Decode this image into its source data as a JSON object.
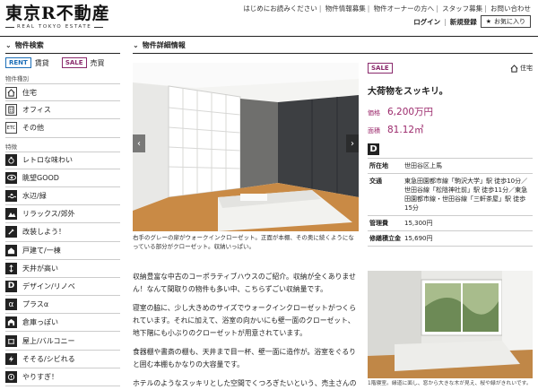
{
  "header": {
    "logo": "東京R不動産",
    "logo_sub": "REAL TOKYO ESTATE",
    "nav": [
      "はじめにお読みください",
      "物件情報募集",
      "物件オーナーの方へ",
      "スタッフ募集",
      "お問い合わせ"
    ],
    "login": "ログイン",
    "register": "新規登録",
    "favorites": "お気に入り"
  },
  "sidebar": {
    "title": "物件検索",
    "rent_badge": "RENT",
    "rent_label": "賃貸",
    "sale_badge": "SALE",
    "sale_label": "売買",
    "type_group": "物件種別",
    "types": [
      {
        "label": "住宅",
        "icon": "house-icon"
      },
      {
        "label": "オフィス",
        "icon": "office-icon"
      },
      {
        "label": "その他",
        "icon": "etc-icon",
        "glyph": "ETC"
      }
    ],
    "feature_group": "特徴",
    "features": [
      {
        "label": "レトロな味わい",
        "icon": "retro-icon"
      },
      {
        "label": "眺望GOOD",
        "icon": "eye-icon"
      },
      {
        "label": "水辺/緑",
        "icon": "waterside-icon"
      },
      {
        "label": "リラックス/郊外",
        "icon": "relax-icon"
      },
      {
        "label": "改装しよう！",
        "icon": "renovate-icon"
      },
      {
        "label": "戸建て/一棟",
        "icon": "detached-house-icon"
      },
      {
        "label": "天井が高い",
        "icon": "high-ceiling-icon"
      },
      {
        "label": "デザイン/リノベ",
        "icon": "design-icon",
        "glyph": "D"
      },
      {
        "label": "プラスα",
        "icon": "plus-alpha-icon",
        "glyph": "α"
      },
      {
        "label": "倉庫っぽい",
        "icon": "warehouse-icon"
      },
      {
        "label": "屋上/バルコニー",
        "icon": "rooftop-icon"
      },
      {
        "label": "そそる/シビれる",
        "icon": "exciting-icon"
      },
      {
        "label": "やりすぎ！",
        "icon": "overdone-icon"
      }
    ]
  },
  "main": {
    "section_title": "物件詳細情報",
    "photo_caption": "右手のグレーの扉がウォークインクローゼット。正面が本棚、その奥に続くようになっている部分がクローゼット。収納いっぱい。",
    "description": [
      "収納豊富な中古のコーポラティブハウスのご紹介。収納が全くありません！なんて間取りの物件も多い中、こちらずごい収納量です。",
      "寝室の脇に、少し大きめのサイズでウォークインクローゼットがつくられています。それに加えて、浴室の向かいにも壁一面のクローゼット、地下階にも小ぶりのクローゼットが用意されています。",
      "食器棚や書斎の棚も、天井まで目一杯、壁一面に造作が。浴室をぐるりと囲む本棚もかなりの大容量です。",
      "ホテルのようなスッキリとした空間でくつろぎたいという、売主さんの"
    ],
    "photo2_caption": "1階寝室。縁道に面し、窓から大きな木が見え、桜や緑がきれいです。"
  },
  "detail": {
    "sale_tag": "SALE",
    "kind": "住宅",
    "title": "大荷物をスッキリ。",
    "price_label": "価格",
    "price": "6,200万円",
    "area_label": "面積",
    "area": "81.12㎡",
    "design_mark": "D",
    "rows": [
      {
        "key": "所在地",
        "value": "世田谷区上馬"
      },
      {
        "key": "交通",
        "value": "東急田園都市線「駒沢大学」駅 徒歩10分／世田谷線「松陰神社前」駅 徒歩11分／東急田園都市線・世田谷線「三軒茶屋」駅 徒歩15分"
      },
      {
        "key": "管理費",
        "value": "15,300円"
      },
      {
        "key": "修繕積立金",
        "value": "15,690円"
      }
    ]
  },
  "colors": {
    "sale": "#8a2a6c",
    "rent": "#1d6fb8",
    "price": "#9c2a6c"
  }
}
